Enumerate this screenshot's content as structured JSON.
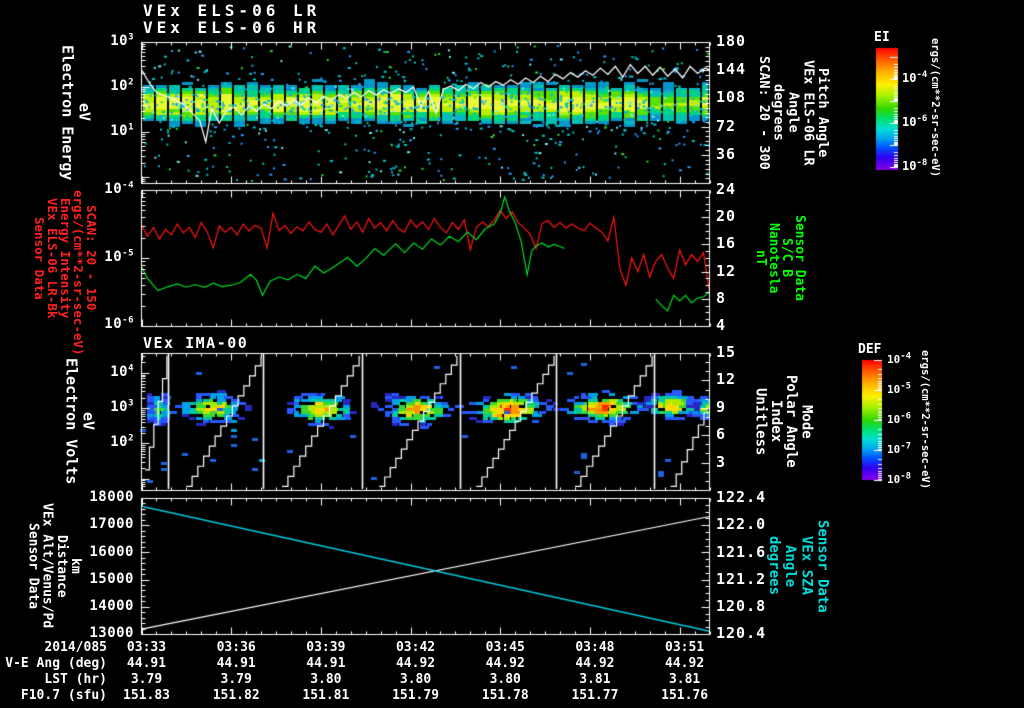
{
  "p1": {
    "titles": [
      "VEx ELS-06 LR",
      "VEx ELS-06 HR"
    ],
    "left_label_lines": [
      "Electron Energy",
      "eV"
    ],
    "left_ticks": [
      "10^3",
      "10^2",
      "10^1"
    ],
    "right_ticks": [
      "180",
      "144",
      "108",
      "72",
      "36"
    ],
    "right_label_lines": [
      "Pitch Angle",
      "VEx ELS-06 LR",
      "Angle",
      "degrees",
      "SCAN: 20 - 300"
    ]
  },
  "p2": {
    "left_label_lines": [
      "Sensor Data",
      "VEx ELS-06 LR-Bk",
      "Energy Intensity",
      "ergs/(cm**2-sr-sec-eV)",
      "SCAN: 20 - 150"
    ],
    "left_ticks": [
      "10^-4",
      "10^-5",
      "10^-6"
    ],
    "right_ticks": [
      "24",
      "20",
      "16",
      "12",
      "8",
      "4"
    ],
    "right_label_lines": [
      "Sensor Data",
      "S/C B",
      "Nanotesla",
      "nT"
    ]
  },
  "p3": {
    "title": "VEx IMA-00",
    "left_label_lines": [
      "Electron Volts",
      "eV"
    ],
    "left_ticks": [
      "10^4",
      "10^3",
      "10^2"
    ],
    "right_ticks": [
      "15",
      "12",
      "9",
      "6",
      "3"
    ],
    "right_label_lines": [
      "Mode",
      "Polar Angle",
      "Index",
      "Unitless"
    ]
  },
  "p4": {
    "left_label_lines": [
      "Sensor Data",
      "VEx Alt/Venus/Pd",
      "Distance",
      "km"
    ],
    "left_ticks": [
      "18000",
      "17000",
      "16000",
      "15000",
      "14000",
      "13000"
    ],
    "right_ticks": [
      "122.4",
      "122.0",
      "121.6",
      "121.2",
      "120.8",
      "120.4"
    ],
    "right_label_lines": [
      "Sensor Data",
      "VEx SZA",
      "Angle",
      "degrees"
    ]
  },
  "colorbars": [
    {
      "title": "EI",
      "ticks": [
        "10^-4",
        "10^-6",
        "10^-8"
      ],
      "units": "ergs/(cm**2-sr-sec-eV)"
    },
    {
      "title": "DEF",
      "ticks": [
        "10^-4",
        "10^-5",
        "10^-6",
        "10^-7",
        "10^-8"
      ],
      "units": "ergs/(cm**2-sr-sec-eV)"
    }
  ],
  "bottom_table": {
    "rows": [
      {
        "label": "2014/085",
        "values": [
          "03:33",
          "03:36",
          "03:39",
          "03:42",
          "03:45",
          "03:48",
          "03:51"
        ]
      },
      {
        "label": "V-E Ang (deg)",
        "values": [
          "44.91",
          "44.91",
          "44.91",
          "44.92",
          "44.92",
          "44.92",
          "44.92"
        ]
      },
      {
        "label": "LST (hr)",
        "values": [
          "3.79",
          "3.79",
          "3.80",
          "3.80",
          "3.80",
          "3.81",
          "3.81"
        ]
      },
      {
        "label": "F10.7 (sfu)",
        "values": [
          "151.83",
          "151.82",
          "151.81",
          "151.79",
          "151.78",
          "151.77",
          "151.76"
        ]
      }
    ]
  },
  "colors": {
    "white": "#ffffff",
    "red_line": "#ff1616",
    "green_line": "#00dc28",
    "cyan_line": "#00c8dc",
    "label_red": "#ff2020",
    "label_green": "#00ff00",
    "label_cyan": "#00dcdc"
  },
  "chart_data": [
    {
      "id": "els_energy_spectrogram",
      "type": "heatmap",
      "title": "VEx ELS-06 LR / VEx ELS-06 HR",
      "x_axis": {
        "label": "UT 2014/085",
        "start": "03:33",
        "end": "03:52",
        "major_ticks": [
          "03:33",
          "03:36",
          "03:39",
          "03:42",
          "03:45",
          "03:48",
          "03:51"
        ]
      },
      "y_axis": {
        "label": "Electron Energy eV",
        "scale": "log",
        "range": [
          0.7,
          1000
        ]
      },
      "z_axis": {
        "label": "EI ergs/(cm**2-sr-sec-eV)",
        "scale": "log",
        "range": [
          1e-08,
          0.0001
        ]
      },
      "right_axis": {
        "label": "Pitch Angle degrees SCAN: 20 - 300",
        "range": [
          0,
          180
        ]
      },
      "band": {
        "center_ev": 40,
        "sigma_decades": 0.33,
        "note": "continuous yellow-green 10-100 eV electron band over full interval, dimmer/cyan after 03:50, cyan-blue speckle noise above and below"
      },
      "overlay_line": {
        "name": "white mean-energy / pitch trace",
        "color": "#ffffff",
        "x_min": [
          0,
          0.25,
          0.5,
          0.8,
          1.1,
          1.4,
          1.7,
          1.95,
          2.15,
          2.35,
          2.6,
          2.85,
          3.1,
          3.35,
          3.6,
          3.85,
          4.1,
          4.35,
          4.6,
          4.85,
          5.1,
          5.35,
          5.6,
          5.85,
          6.1,
          6.35,
          6.6,
          6.85,
          7.1,
          7.35,
          7.6,
          7.85,
          8.1,
          8.35,
          8.6,
          8.85,
          9.1,
          9.35,
          9.6,
          9.85,
          10.1,
          10.35,
          10.6,
          10.85,
          11.1,
          11.35,
          11.6,
          11.85,
          12.1,
          12.35,
          12.6,
          12.85,
          13.1,
          13.35,
          13.6,
          13.85,
          14.1,
          14.35,
          14.6,
          14.85,
          15.1,
          15.35,
          15.6,
          15.85,
          16.1,
          16.35,
          16.6,
          16.85,
          17.1,
          17.35,
          17.6,
          17.85,
          18.1,
          18.35,
          18.6,
          18.85,
          19
        ],
        "log10_ev": [
          2.38,
          2.1,
          1.88,
          1.8,
          1.72,
          1.62,
          1.42,
          1.25,
          0.78,
          1.52,
          1.2,
          1.48,
          1.55,
          1.38,
          1.58,
          1.46,
          1.62,
          1.52,
          1.68,
          1.58,
          1.72,
          1.6,
          1.76,
          1.64,
          1.8,
          1.7,
          1.84,
          1.74,
          1.88,
          1.78,
          1.92,
          1.82,
          1.94,
          1.86,
          1.96,
          1.88,
          2.0,
          1.55,
          1.9,
          1.42,
          1.95,
          2.02,
          1.92,
          2.06,
          1.96,
          2.1,
          2.0,
          2.12,
          2.04,
          2.16,
          2.06,
          2.2,
          2.1,
          2.24,
          2.12,
          2.28,
          2.18,
          2.32,
          2.22,
          2.36,
          2.26,
          2.42,
          2.28,
          2.46,
          2.22,
          2.5,
          2.3,
          2.46,
          2.26,
          2.44,
          2.24,
          2.4,
          2.2,
          2.46,
          2.3,
          2.42,
          2.38
        ]
      }
    },
    {
      "id": "els_background_and_b_field",
      "type": "line",
      "y_axis": {
        "label": "Energy Intensity ergs/(cm**2-sr-sec-eV)",
        "scale": "log",
        "range": [
          1e-06,
          0.0001
        ]
      },
      "right_axis": {
        "label": "S/C B Nanotesla nT",
        "range": [
          4,
          24
        ]
      },
      "series": [
        {
          "name": "VEx ELS-06 LR-Bk Energy Intensity (red)",
          "color": "#ff1616",
          "x_start_min": 0,
          "x_step_min": 0.2,
          "log10_y": [
            -4.52,
            -4.68,
            -4.55,
            -4.72,
            -4.58,
            -4.66,
            -4.5,
            -4.63,
            -4.55,
            -4.7,
            -4.48,
            -4.62,
            -4.85,
            -4.53,
            -4.62,
            -4.55,
            -4.66,
            -4.5,
            -4.6,
            -4.52,
            -4.56,
            -4.85,
            -4.34,
            -4.6,
            -4.52,
            -4.64,
            -4.54,
            -4.6,
            -4.47,
            -4.58,
            -4.62,
            -4.5,
            -4.66,
            -4.52,
            -4.38,
            -4.58,
            -4.47,
            -4.62,
            -4.42,
            -4.56,
            -4.48,
            -4.6,
            -4.45,
            -4.57,
            -4.62,
            -4.44,
            -4.55,
            -4.47,
            -4.58,
            -4.42,
            -4.55,
            -4.63,
            -4.48,
            -4.58,
            -4.44,
            -4.88,
            -4.55,
            -4.47,
            -4.54,
            -4.44,
            -4.3,
            -4.42,
            -4.32,
            -4.48,
            -4.56,
            -4.65,
            -4.86,
            -4.49,
            -4.45,
            -4.55,
            -4.48,
            -4.56,
            -4.5,
            -4.56,
            -4.6,
            -4.49,
            -4.56,
            -4.62,
            -4.75,
            -4.4,
            -5.15,
            -5.4,
            -5.0,
            -5.2,
            -4.95,
            -5.28,
            -5.05,
            -4.95,
            -5.15,
            -5.3,
            -4.88,
            -5.1,
            -4.95,
            -5.05,
            -4.92,
            -5.5
          ]
        },
        {
          "name": "S/C B (green)",
          "color": "#00dc28",
          "segments": [
            {
              "x_min": [
                0,
                0.2,
                0.55,
                0.9,
                1.2,
                1.5,
                1.8,
                2.1,
                2.4,
                2.7,
                3,
                3.3,
                3.65,
                3.85,
                4.05,
                4.3,
                4.6,
                4.9,
                5.2,
                5.5,
                5.8,
                6.1,
                6.4,
                6.9,
                7.2,
                7.5,
                7.8,
                8.1,
                8.5,
                8.8,
                9.1,
                9.4,
                9.7,
                10,
                10.3,
                10.6,
                10.9,
                11.2,
                11.5,
                11.8,
                12,
                12.15,
                12.3,
                12.5,
                12.7,
                12.9,
                13.05,
                13.2,
                13.4,
                13.6,
                13.8,
                14,
                14.15
              ],
              "log10_y": [
                -5.13,
                -5.3,
                -5.48,
                -5.42,
                -5.38,
                -5.43,
                -5.39,
                -5.43,
                -5.37,
                -5.42,
                -5.4,
                -5.36,
                -5.24,
                -5.33,
                -5.55,
                -5.34,
                -5.28,
                -5.32,
                -5.24,
                -5.3,
                -5.12,
                -5.22,
                -5.14,
                -4.99,
                -5.12,
                -5.01,
                -4.86,
                -4.96,
                -4.79,
                -4.92,
                -4.78,
                -4.87,
                -4.72,
                -4.81,
                -4.68,
                -4.76,
                -4.62,
                -4.73,
                -4.57,
                -4.5,
                -4.34,
                -4.1,
                -4.3,
                -4.48,
                -4.76,
                -5.25,
                -4.9,
                -4.82,
                -4.78,
                -4.84,
                -4.8,
                -4.83,
                -4.86
              ]
            },
            {
              "x_min": [
                17.2,
                17.4,
                17.6,
                17.8,
                18,
                18.2,
                18.4,
                18.6,
                18.8,
                19
              ],
              "log10_y": [
                -5.6,
                -5.7,
                -5.78,
                -5.55,
                -5.63,
                -5.55,
                -5.66,
                -5.59,
                -5.57,
                -5.5
              ]
            }
          ]
        }
      ]
    },
    {
      "id": "ima_spectrogram",
      "type": "heatmap",
      "title": "VEx IMA-00",
      "y_axis": {
        "label": "Electron Volts eV",
        "scale": "log",
        "range": [
          5,
          30000
        ]
      },
      "z_axis": {
        "label": "DEF ergs/(cm**2-sr-sec-eV)",
        "scale": "log",
        "range": [
          1e-08,
          0.0001
        ]
      },
      "right_axis": {
        "label": "Mode / Polar Angle Index (Unitless)",
        "range": [
          0,
          15
        ]
      },
      "blobs": [
        {
          "t_min": 0.45,
          "sigma_min": 0.2,
          "log10_ev": 3.0,
          "sigma_log": 0.25,
          "peak": 0.45
        },
        {
          "t_min": 2.2,
          "sigma_min": 0.55,
          "log10_ev": 3.05,
          "sigma_log": 0.22,
          "peak": 0.75
        },
        {
          "t_min": 5.9,
          "sigma_min": 0.55,
          "log10_ev": 3.0,
          "sigma_log": 0.24,
          "peak": 0.8
        },
        {
          "t_min": 9.1,
          "sigma_min": 0.6,
          "log10_ev": 3.0,
          "sigma_log": 0.22,
          "peak": 0.85
        },
        {
          "t_min": 12.2,
          "sigma_min": 0.65,
          "log10_ev": 3.0,
          "sigma_log": 0.24,
          "peak": 0.97
        },
        {
          "t_min": 15.3,
          "sigma_min": 0.65,
          "log10_ev": 3.05,
          "sigma_log": 0.22,
          "peak": 0.93
        },
        {
          "t_min": 17.6,
          "sigma_min": 0.45,
          "log10_ev": 3.1,
          "sigma_log": 0.2,
          "peak": 0.8
        },
        {
          "t_min": 18.95,
          "sigma_min": 0.3,
          "log10_ev": 3.0,
          "sigma_log": 0.2,
          "peak": 0.72
        }
      ],
      "scan_separators_t_min": [
        0.88,
        4.08,
        7.36,
        10.64,
        13.88,
        17.16
      ],
      "polar_angle_sweeps": [
        {
          "t0": 0.12,
          "i0": 2.2,
          "t1": 0.85,
          "i1": 14.7
        },
        {
          "t0": 1.5,
          "i0": 0.4,
          "t1": 4.0,
          "i1": 14.7
        },
        {
          "t0": 4.7,
          "i0": 0.4,
          "t1": 7.28,
          "i1": 14.7
        },
        {
          "t0": 7.95,
          "i0": 0.4,
          "t1": 10.55,
          "i1": 14.7
        },
        {
          "t0": 11.2,
          "i0": 0.4,
          "t1": 13.8,
          "i1": 14.7
        },
        {
          "t0": 14.5,
          "i0": 0.4,
          "t1": 17.08,
          "i1": 14.7
        },
        {
          "t0": 17.7,
          "i0": 0.4,
          "t1": 19.0,
          "i1": 9.8
        }
      ]
    },
    {
      "id": "altitude_sza",
      "type": "line",
      "left_axis": {
        "label": "VEx Alt/Venus/Pd Distance km",
        "range": [
          13000,
          18000
        ]
      },
      "right_axis": {
        "label": "VEx SZA Angle degrees",
        "range": [
          120.4,
          122.4
        ]
      },
      "series": [
        {
          "name": "VEx Alt/Venus/Pd Distance km",
          "color": "#ffffff",
          "axis": "left",
          "x_min": [
            0,
            19
          ],
          "y": [
            13180,
            17320
          ]
        },
        {
          "name": "VEx SZA Angle degrees",
          "color": "#00c8dc",
          "axis": "right",
          "x_min": [
            0,
            19
          ],
          "y": [
            122.28,
            120.44
          ]
        }
      ]
    }
  ]
}
